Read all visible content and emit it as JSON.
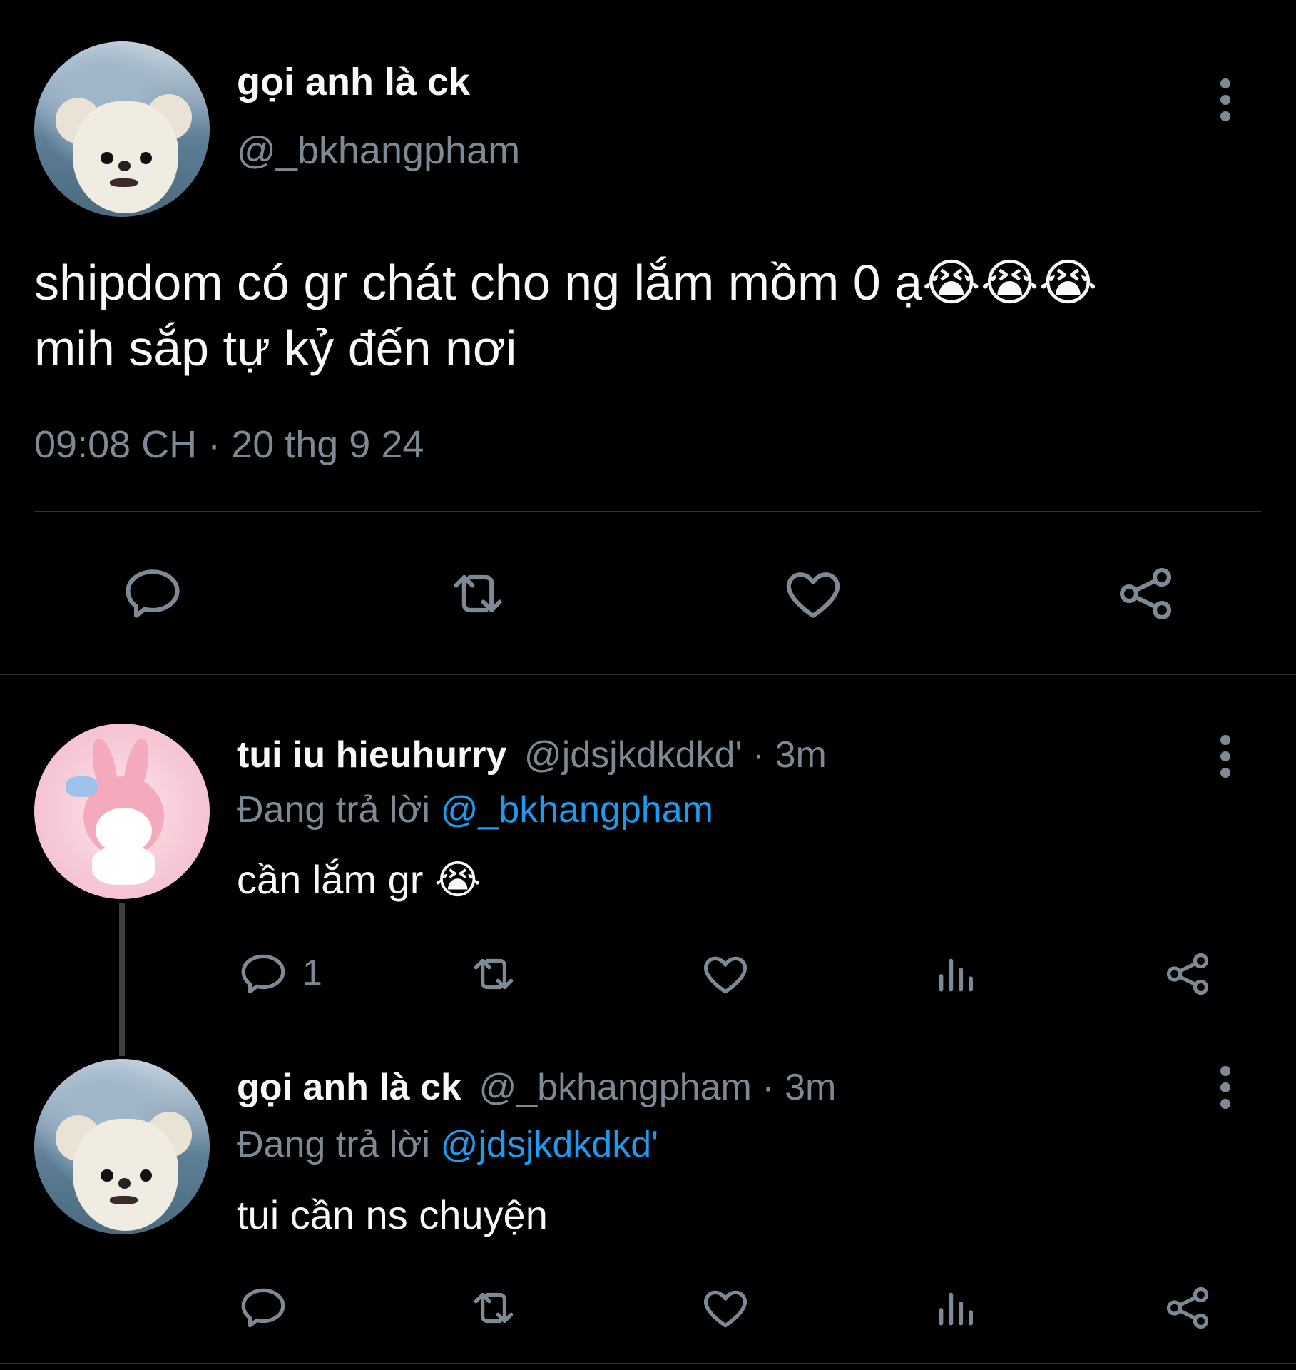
{
  "main_tweet": {
    "display_name": "gọi anh là ck",
    "handle": "@_bkhangpham",
    "text_line1": "shipdom có gr chát cho ng lắm mồm 0 ạ",
    "text_emojis": "😭😭😭",
    "text_line2": "mih sắp tự kỷ đến nơi",
    "time": "09:08 CH",
    "sep": "·",
    "date": "20 thg 9 24"
  },
  "reply1": {
    "display_name": "tui iu hieuhurry",
    "handle": "@jdsjkdkdkd'",
    "dot": "·",
    "time": "3m",
    "replying_prefix": "Đang trả lời",
    "replying_to": "@_bkhangpham",
    "text": "cần lắm gr",
    "emoji": "😭",
    "reply_count": "1"
  },
  "reply2": {
    "display_name": "gọi anh là ck",
    "handle": "@_bkhangpham",
    "dot": "·",
    "time": "3m",
    "replying_prefix": "Đang trả lời",
    "replying_to": "@jdsjkdkdkd'",
    "text": "tui cần ns chuyện"
  },
  "icons": {
    "reply": "reply-icon",
    "retweet": "retweet-icon",
    "like": "heart-icon",
    "share": "share-icon",
    "views": "analytics-icon",
    "more": "more-options-icon"
  },
  "colors": {
    "background": "#000000",
    "text": "#e7e9ea",
    "muted": "#7d8a96",
    "link": "#1d9bf0",
    "divider": "#2f3336"
  }
}
